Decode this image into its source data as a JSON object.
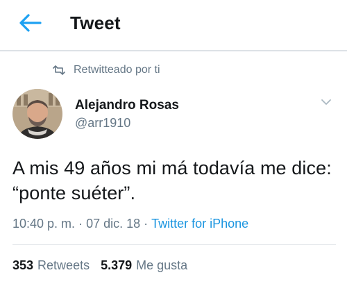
{
  "header": {
    "title": "Tweet",
    "back_icon": "arrow-left-icon"
  },
  "retweet": {
    "icon": "retweet-icon",
    "text": "Retwitteado por ti"
  },
  "author": {
    "name": "Alejandro Rosas",
    "handle": "@arr1910"
  },
  "tweet": {
    "text": "A mis 49 años mi má todavía me dice: “ponte suéter”."
  },
  "meta": {
    "time": "10:40 p. m.",
    "separator": "·",
    "date": "07 dic. 18",
    "source": "Twitter for iPhone"
  },
  "stats": {
    "retweets_count": "353",
    "retweets_label": "Retweets",
    "likes_count": "5.379",
    "likes_label": "Me gusta"
  },
  "colors": {
    "accent": "#1da1f2",
    "link": "#1b95e0",
    "secondary_text": "#657786",
    "divider": "#dde2e6"
  }
}
